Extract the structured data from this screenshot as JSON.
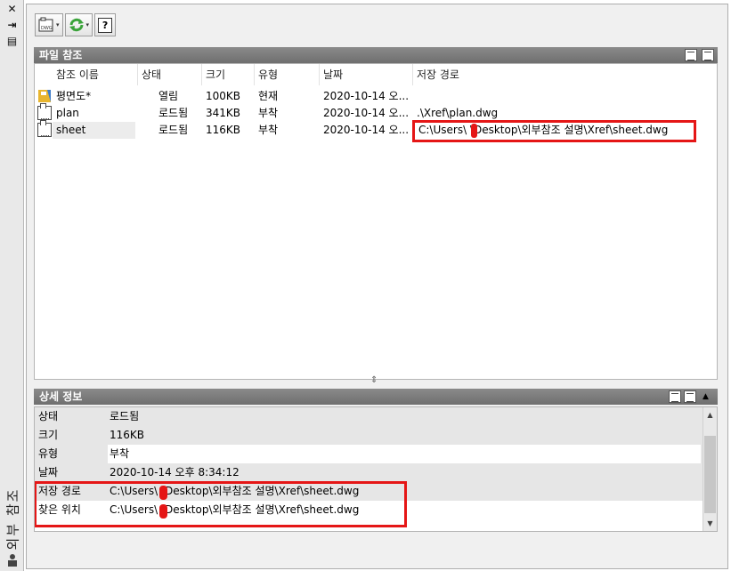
{
  "palette": {
    "title": "외부 참조",
    "close_glyph": "✕",
    "pin_glyph": "⇥",
    "menu_glyph": "▤"
  },
  "toolbar": {
    "attach_caret": "▾",
    "refresh_caret": "▾",
    "help_label": "?"
  },
  "file_refs": {
    "header": "파일 참조",
    "columns": [
      "참조 이름",
      "상태",
      "크기",
      "유형",
      "날짜",
      "저장 경로"
    ],
    "rows": [
      {
        "name": "평면도*",
        "status": "열림",
        "size": "100KB",
        "type": "현재",
        "date": "2020-10-14 오...",
        "path": ""
      },
      {
        "name": "plan",
        "status": "로드됨",
        "size": "341KB",
        "type": "부착",
        "date": "2020-10-14 오...",
        "path": ".\\Xref\\plan.dwg"
      },
      {
        "name": "sheet",
        "status": "로드됨",
        "size": "116KB",
        "type": "부착",
        "date": "2020-10-14 오...",
        "path": "C:\\Users\\  \\Desktop\\외부참조 설명\\Xref\\sheet.dwg"
      }
    ]
  },
  "details": {
    "header": "상세 정보",
    "rows": [
      {
        "label": "상태",
        "value": "로드됨"
      },
      {
        "label": "크기",
        "value": "116KB"
      },
      {
        "label": "유형",
        "value": "부착"
      },
      {
        "label": "날짜",
        "value": "2020-10-14 오후 8:34:12"
      },
      {
        "label": "저장 경로",
        "value": "C:\\Users\\   \\Desktop\\외부참조 설명\\Xref\\sheet.dwg"
      },
      {
        "label": "찾은 위치",
        "value": "C:\\Users\\   \\Desktop\\외부참조 설명\\Xref\\sheet.dwg"
      }
    ]
  },
  "colors": {
    "highlight_red": "#e51616",
    "header_gray": "#7b7b7b",
    "refresh_green": "#3aa33a"
  }
}
